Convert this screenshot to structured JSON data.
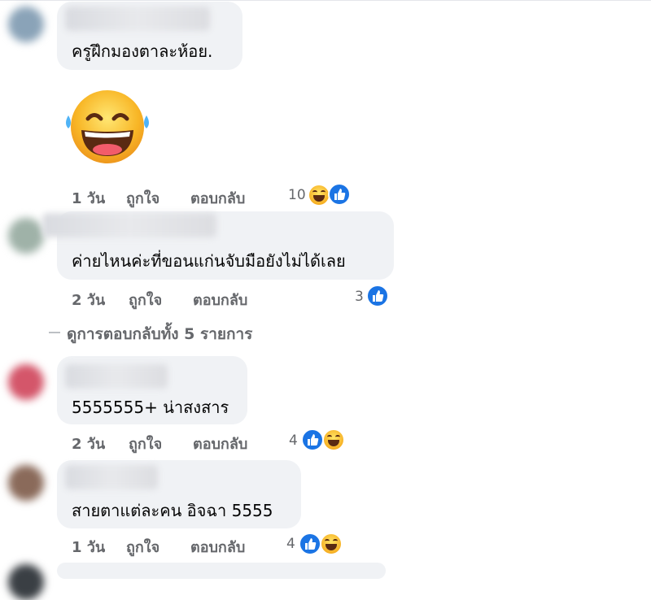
{
  "comments": [
    {
      "text": "ครูฝึกมองตาละห้อย.",
      "time": "1 วัน",
      "like_label": "ถูกใจ",
      "reply_label": "ตอบกลับ",
      "reaction_count": "10"
    },
    {
      "text": "ค่ายไหนค่ะที่ขอนแก่นจับมือยังไม่ได้เลย",
      "time": "2 วัน",
      "like_label": "ถูกใจ",
      "reply_label": "ตอบกลับ",
      "reaction_count": "3"
    },
    {
      "text": "5555555+ น่าสงสาร",
      "time": "2 วัน",
      "like_label": "ถูกใจ",
      "reply_label": "ตอบกลับ",
      "reaction_count": "4"
    },
    {
      "text": "สายตาแต่ละคน อิจฉา 5555",
      "time": "1 วัน",
      "like_label": "ถูกใจ",
      "reply_label": "ตอบกลับ",
      "reaction_count": "4"
    }
  ],
  "view_replies": "ดูการตอบกลับทั้ง 5 รายการ",
  "colors": {
    "bubble": "#f0f2f5",
    "meta": "#65676b",
    "like_blue": "#1b74e4",
    "haha_yellow": "#f7b125"
  },
  "icons": {
    "like": "like-reaction-icon",
    "haha": "haha-reaction-icon",
    "sticker": "laughing-emoji-sticker"
  }
}
